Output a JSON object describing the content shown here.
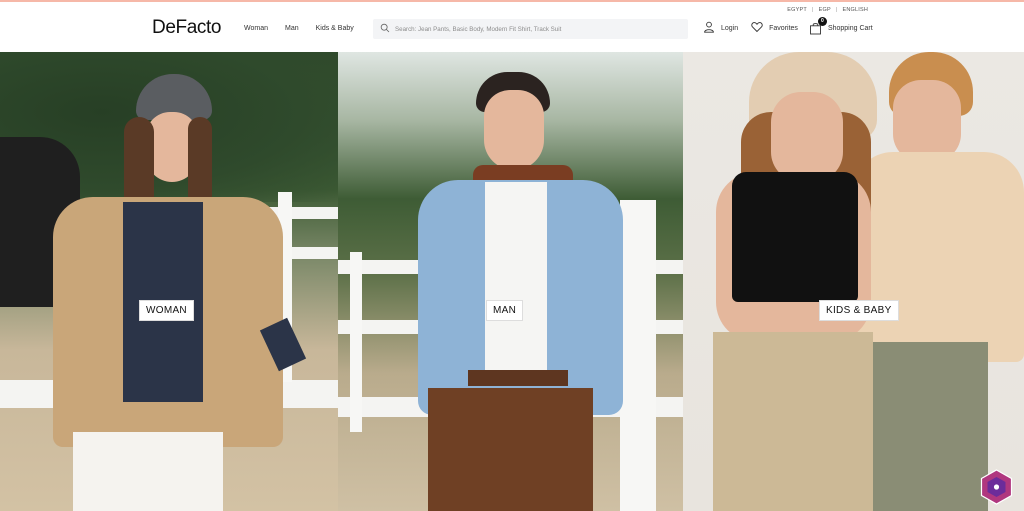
{
  "locale": {
    "country": "EGYPT",
    "currency": "EGP",
    "language": "ENGLISH"
  },
  "brand": {
    "logo": "DeFacto"
  },
  "nav": {
    "items": [
      "Woman",
      "Man",
      "Kids & Baby"
    ]
  },
  "search": {
    "placeholder": "Search: Jean Pants, Basic Body, Modern Fit Shirt, Track Suit",
    "value": ""
  },
  "actions": {
    "login": "Login",
    "favorites": "Favorites",
    "cart": "Shopping Cart",
    "cart_count": "0"
  },
  "hero": {
    "panels": [
      {
        "label": "WOMAN"
      },
      {
        "label": "MAN"
      },
      {
        "label": "KIDS & BABY"
      }
    ]
  },
  "colors": {
    "accent_strip": "#f6b8a8",
    "chat_badge": "#b0377f"
  }
}
